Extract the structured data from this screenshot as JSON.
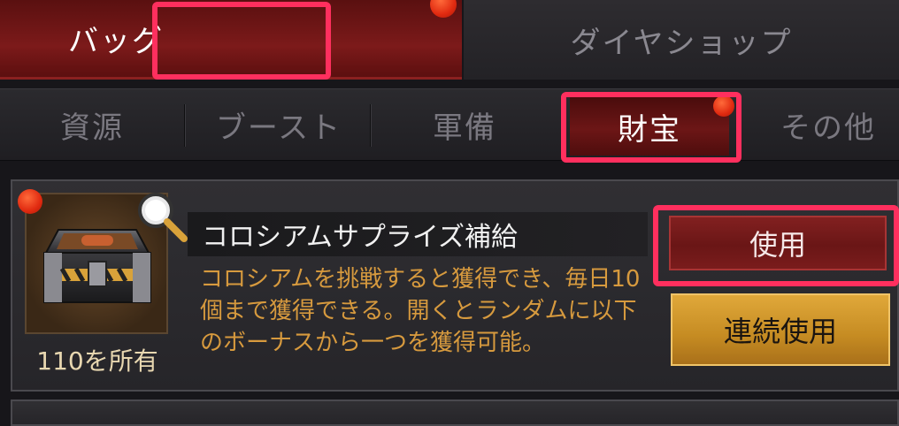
{
  "top_tabs": {
    "bag": "バッグ",
    "diamond_shop": "ダイヤショップ"
  },
  "sub_tabs": {
    "resources": "資源",
    "boost": "ブースト",
    "armament": "軍備",
    "treasure": "財宝",
    "other": "その他"
  },
  "item": {
    "title": "コロシアムサプライズ補給",
    "description": "コロシアムを挑戦すると獲得でき、毎日10個まで獲得できる。開くとランダムに以下のボーナスから一つを獲得可能。",
    "owned": "110を所有",
    "icons": [
      "chest-icon",
      "magnifier-icon",
      "notification-dot"
    ]
  },
  "buttons": {
    "use": "使用",
    "use_multiple": "連続使用"
  },
  "colors": {
    "highlight": "#ff2f5e",
    "notification_dot": "#e02a10",
    "description_text": "#d79a3e",
    "use_button": "#7a1c1c",
    "use_multiple_button": "#c58b22"
  }
}
